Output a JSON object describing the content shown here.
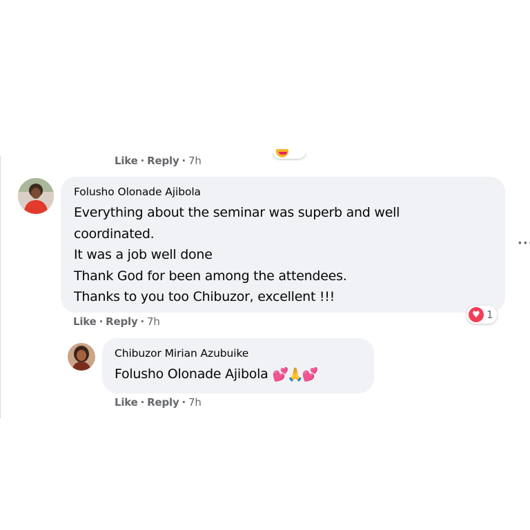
{
  "actions": {
    "like": "Like",
    "separator": "·",
    "reply": "Reply"
  },
  "previous_comment": {
    "time": "7h"
  },
  "comments": [
    {
      "author": "Folusho Olonade Ajibola",
      "lines": [
        "Everything about the seminar was superb and well",
        "coordinated.",
        "It was a job well done",
        "Thank God for been among the attendees.",
        "Thanks to you too Chibuzor, excellent !!!"
      ],
      "time": "7h",
      "reaction": {
        "icon": "heart-reaction-icon",
        "count": "1"
      }
    },
    {
      "author": "Chibuzor Mirian Azubuike",
      "mention": "Folusho Olonade Ajibola",
      "emojis": "💕🙏💕",
      "time": "7h"
    }
  ],
  "colors": {
    "bubble": "#f0f2f5",
    "meta_text": "#65676b",
    "heart_reaction": "#f33e58"
  },
  "icons": [
    "more-options-icon",
    "heart-reaction-icon",
    "avatar-folusho",
    "avatar-chibuzor"
  ]
}
